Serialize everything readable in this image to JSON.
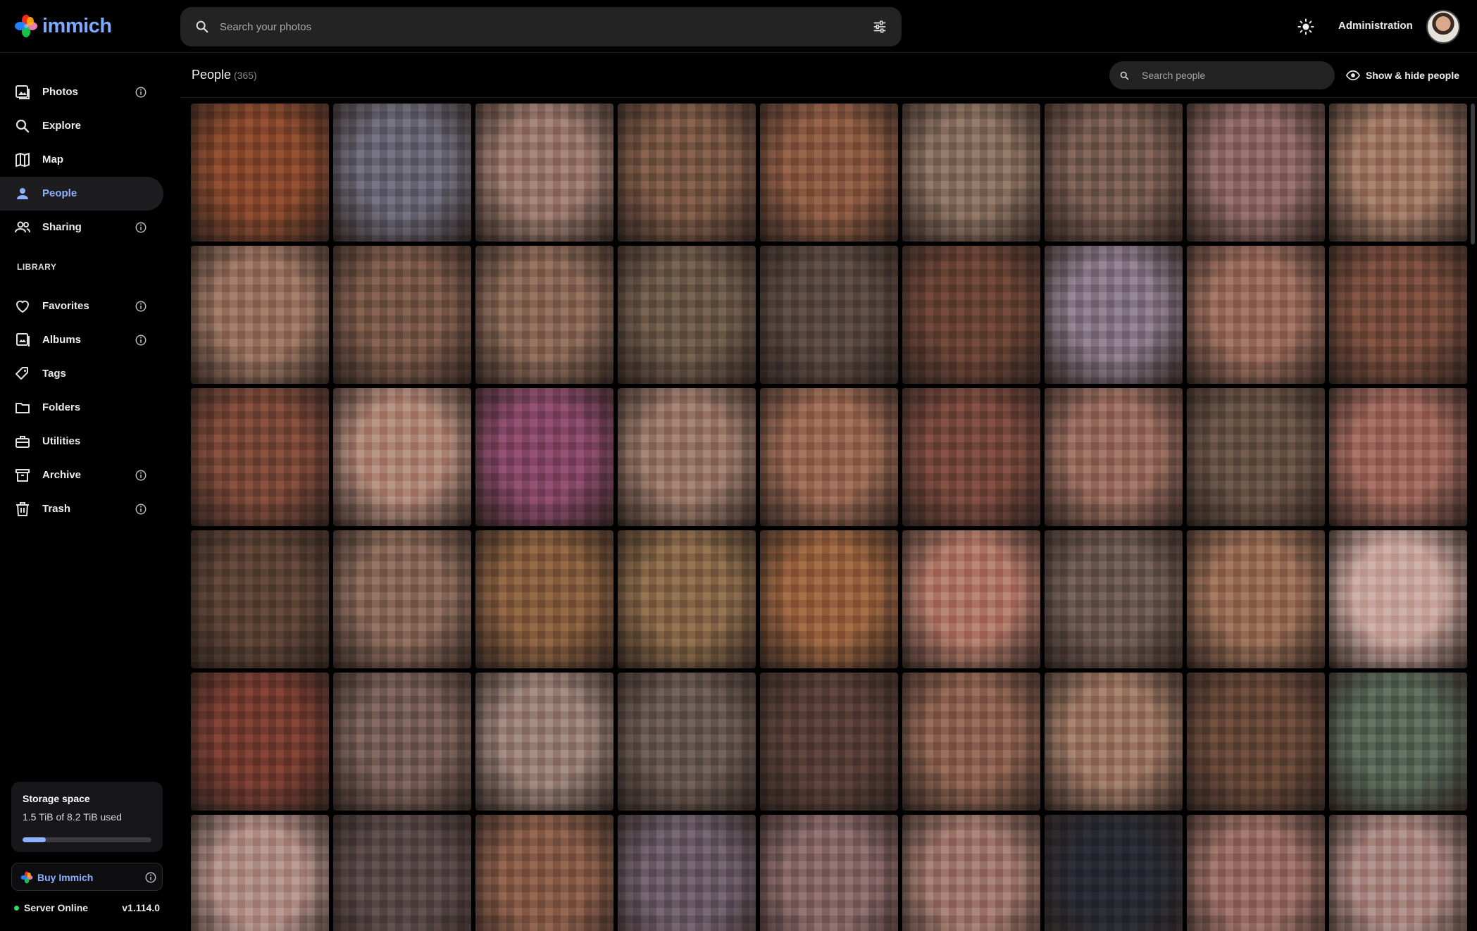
{
  "app": {
    "name": "immich",
    "brand_color": "#7fa8ff"
  },
  "header": {
    "search_placeholder": "Search your photos",
    "admin_label": "Administration",
    "icons": [
      "search-icon",
      "tune-icon",
      "sun-icon",
      "avatar"
    ]
  },
  "sidebar": {
    "items": [
      {
        "label": "Photos",
        "icon": "photos-icon",
        "info": true,
        "active": false
      },
      {
        "label": "Explore",
        "icon": "search-icon",
        "info": false,
        "active": false
      },
      {
        "label": "Map",
        "icon": "map-icon",
        "info": false,
        "active": false
      },
      {
        "label": "People",
        "icon": "person-icon",
        "info": false,
        "active": true
      },
      {
        "label": "Sharing",
        "icon": "sharing-icon",
        "info": true,
        "active": false
      }
    ],
    "library_label": "LIBRARY",
    "library_items": [
      {
        "label": "Favorites",
        "icon": "heart-icon",
        "info": true
      },
      {
        "label": "Albums",
        "icon": "albums-icon",
        "info": true
      },
      {
        "label": "Tags",
        "icon": "tag-icon",
        "info": false
      },
      {
        "label": "Folders",
        "icon": "folder-icon",
        "info": false
      },
      {
        "label": "Utilities",
        "icon": "toolbox-icon",
        "info": false
      },
      {
        "label": "Archive",
        "icon": "archive-icon",
        "info": true
      },
      {
        "label": "Trash",
        "icon": "trash-icon",
        "info": true
      }
    ],
    "storage": {
      "title": "Storage space",
      "used_text": "1.5 TiB of 8.2 TiB used",
      "used_fraction": 0.18
    },
    "buy_label": "Buy Immich",
    "server": {
      "status": "Server Online",
      "version": "v1.114.0",
      "status_color": "#38d46b"
    }
  },
  "people_page": {
    "title": "People",
    "count": "(365)",
    "search_placeholder": "Search people",
    "show_hide_label": "Show & hide people",
    "faces": [
      "#8a4a2e",
      "#6c6a78",
      "#9b7b6e",
      "#7d5a47",
      "#8e5c44",
      "#8a7060",
      "#7a5e52",
      "#8f6a66",
      "#a07a66",
      "#9a7562",
      "#7c5a4a",
      "#8b6a58",
      "#6e5a4a",
      "#5a4a42",
      "#6b4436",
      "#8a7a88",
      "#9b6e5e",
      "#7a4e3e",
      "#7e4a3a",
      "#b08a7a",
      "#8a4a6a",
      "#9a7a6a",
      "#9a6a54",
      "#7a4a3e",
      "#9a6e60",
      "#6a5446",
      "#a06a5e",
      "#5e4436",
      "#8a6a5a",
      "#8a6040",
      "#8a6a4a",
      "#9a6440",
      "#b07a6a",
      "#6e5a52",
      "#9a7058",
      "#c8a8a0",
      "#7a3e32",
      "#7a6058",
      "#9a8278",
      "#6a5a52",
      "#5a4038",
      "#8e6452",
      "#9e7a66",
      "#6a4a3a",
      "#5a6a5a",
      "#b09088",
      "#5a4a4a",
      "#8a5e4a",
      "#6e5e6a",
      "#8a6a6a",
      "#a07a6e",
      "#2a2c34",
      "#9a7066",
      "#aa8a84"
    ]
  }
}
